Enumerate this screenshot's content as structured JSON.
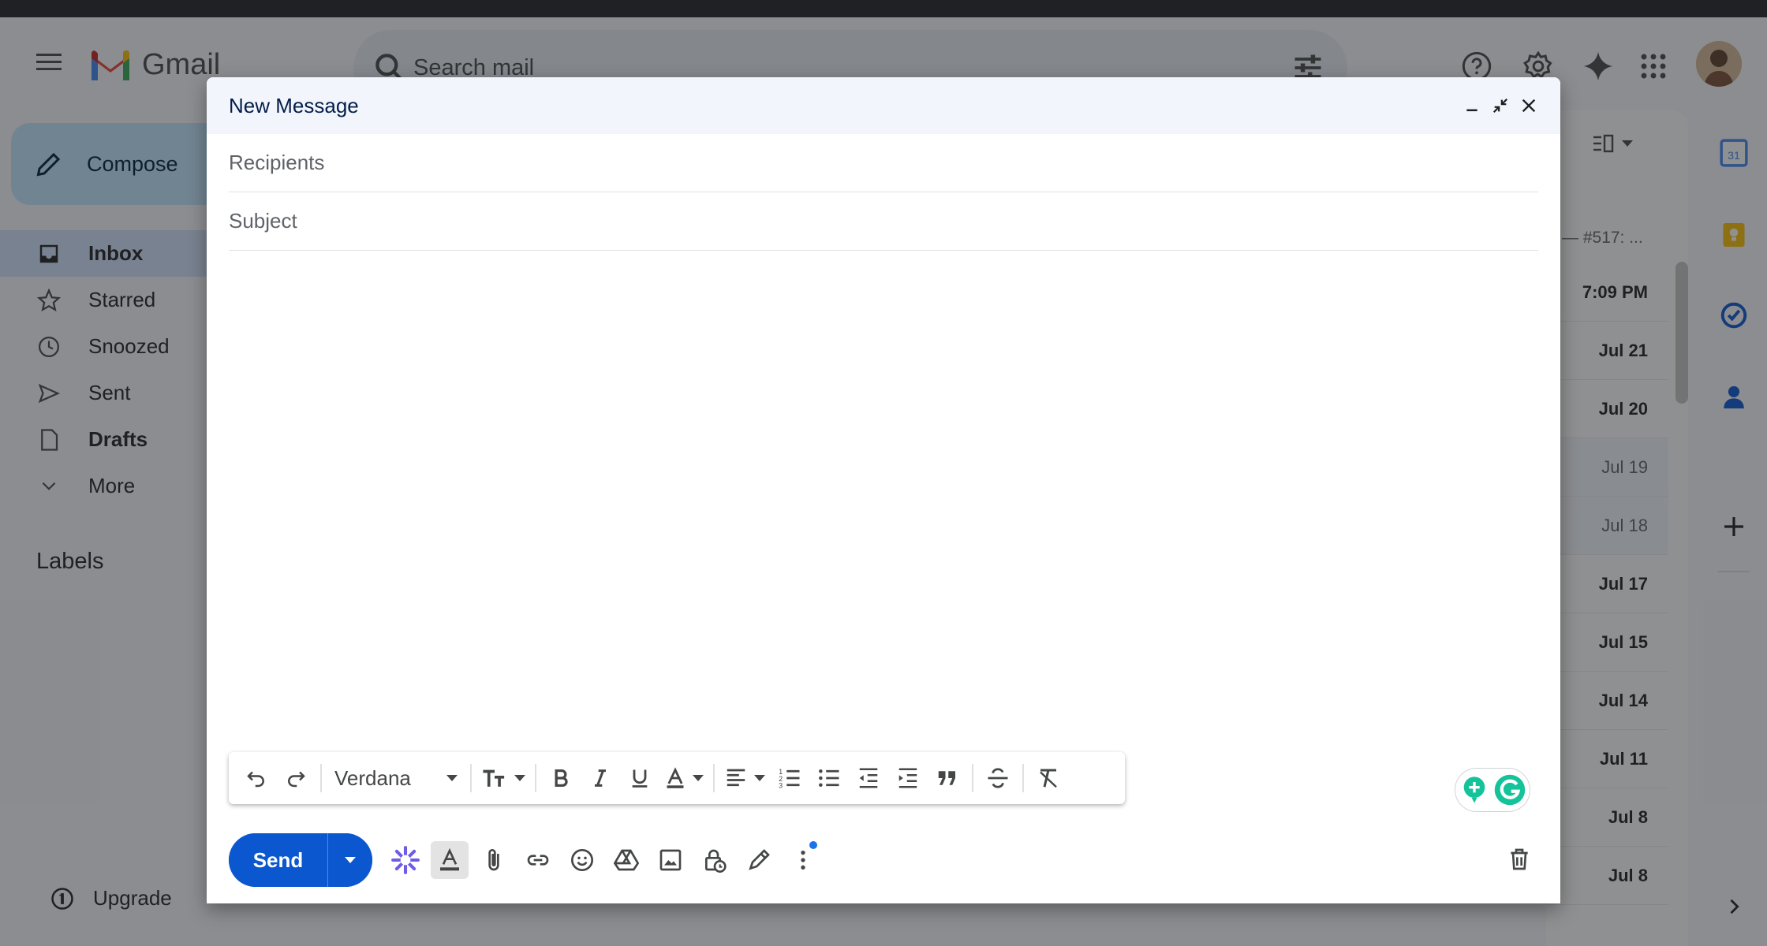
{
  "app": {
    "name": "Gmail"
  },
  "search": {
    "placeholder": "Search mail"
  },
  "compose_button": {
    "label": "Compose"
  },
  "nav": [
    {
      "label": "Inbox"
    },
    {
      "label": "Starred"
    },
    {
      "label": "Snoozed"
    },
    {
      "label": "Sent"
    },
    {
      "label": "Drafts"
    },
    {
      "label": "More"
    }
  ],
  "labels_title": "Labels",
  "upgrade": {
    "label": "Upgrade"
  },
  "list": {
    "snippet": "— #517: ...",
    "dates": [
      "7:09 PM",
      "Jul 21",
      "Jul 20",
      "Jul 19",
      "Jul 18",
      "Jul 17",
      "Jul 15",
      "Jul 14",
      "Jul 11",
      "Jul 8",
      "Jul 8"
    ]
  },
  "rail": {
    "calendar_day": "31"
  },
  "dialog": {
    "title": "New Message",
    "recipients_placeholder": "Recipients",
    "subject_placeholder": "Subject",
    "font": "Verdana",
    "send_label": "Send"
  },
  "colors": {
    "accent": "#0b57d0",
    "compose_bg": "#c2e7ff",
    "grammarly": "#15c39a"
  }
}
